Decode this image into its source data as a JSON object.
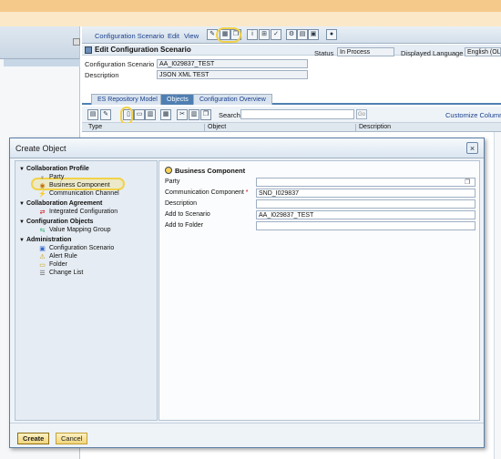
{
  "app": {
    "menu": [
      "Configuration Scenario",
      "Edit",
      "View"
    ],
    "edit_header": "Edit Configuration Scenario",
    "fields": {
      "scenario_label": "Configuration Scenario",
      "scenario_value": "AA_I029837_TEST",
      "description_label": "Description",
      "description_value": "JSON XML TEST",
      "status_label": "Status",
      "status_value": "In Process",
      "language_label": "Displayed Language",
      "language_value": "English (OL"
    },
    "tabs": [
      "ES Repository Model",
      "Objects",
      "Configuration Overview"
    ],
    "search_label": "Search",
    "go_label": "Go",
    "customize_label": "Customize Column",
    "grid_headers": [
      "Type",
      "Object",
      "Description"
    ]
  },
  "dialog": {
    "title": "Create Object",
    "close_symbol": "×",
    "nav": [
      {
        "label": "Collaboration Profile",
        "group": true
      },
      {
        "label": "Party",
        "icon": "party-icon"
      },
      {
        "label": "Business Component",
        "icon": "business-component-icon",
        "selected": true
      },
      {
        "label": "Communication Channel",
        "icon": "communication-channel-icon"
      },
      {
        "label": "Collaboration Agreement",
        "group": true
      },
      {
        "label": "Integrated Configuration",
        "icon": "integrated-config-icon"
      },
      {
        "label": "Configuration Objects",
        "group": true
      },
      {
        "label": "Value Mapping Group",
        "icon": "value-mapping-icon"
      },
      {
        "label": "Administration",
        "group": true
      },
      {
        "label": "Configuration Scenario",
        "icon": "config-scenario-icon"
      },
      {
        "label": "Alert Rule",
        "icon": "alert-rule-icon"
      },
      {
        "label": "Folder",
        "icon": "folder-icon"
      },
      {
        "label": "Change List",
        "icon": "change-list-icon"
      }
    ],
    "form_title": "Business Component",
    "rows": {
      "party": {
        "label": "Party",
        "value": ""
      },
      "comm_component": {
        "label": "Communication Component",
        "value": "SND_I029837"
      },
      "description": {
        "label": "Description",
        "value": ""
      },
      "add_scenario": {
        "label": "Add to Scenario",
        "value": "AA_I029837_TEST"
      },
      "add_folder": {
        "label": "Add to Folder",
        "value": ""
      }
    },
    "required_mark": "*",
    "create_label": "Create",
    "cancel_label": "Cancel"
  },
  "colors": {
    "accent": "#4f7fb2",
    "highlight": "#f2d24a",
    "button": "#f1d57d"
  }
}
